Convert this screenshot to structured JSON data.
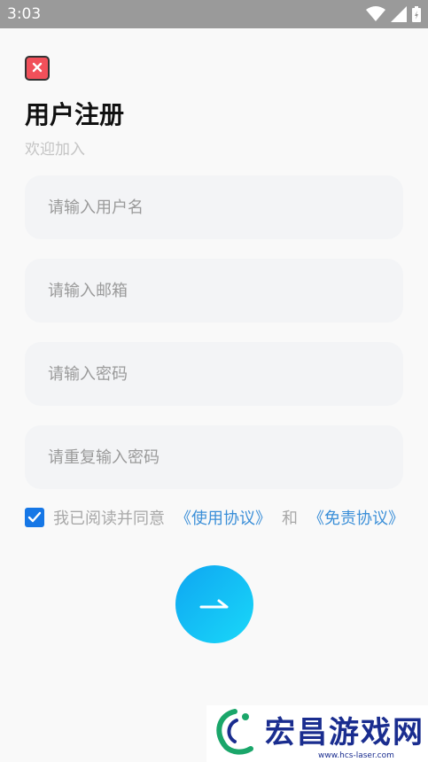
{
  "status_bar": {
    "time": "3:03",
    "icons": [
      "wifi-icon",
      "signal-icon",
      "battery-icon"
    ]
  },
  "header": {
    "close_icon": "close-icon",
    "title": "用户注册",
    "subtitle": "欢迎加入"
  },
  "form": {
    "username_placeholder": "请输入用户名",
    "email_placeholder": "请输入邮箱",
    "password_placeholder": "请输入密码",
    "confirm_password_placeholder": "请重复输入密码"
  },
  "agreement": {
    "checked": true,
    "prefix": "我已阅读并同意",
    "user_agreement": "《使用协议》",
    "conjunction": "和",
    "disclaimer": "《免责协议》"
  },
  "submit": {
    "icon": "arrow-right-icon"
  },
  "watermark": {
    "text": "宏昌游戏网",
    "url": "www.hcs-laser.com"
  },
  "colors": {
    "status_bar": "#9a9a9a",
    "background": "#f9f9f9",
    "field_bg": "#f3f4f6",
    "close_red": "#f1505a",
    "checkbox_blue": "#1677e6",
    "link_blue": "#3b8fd8",
    "submit_gradient_start": "#0fa6f1",
    "submit_gradient_end": "#19d8f9"
  }
}
